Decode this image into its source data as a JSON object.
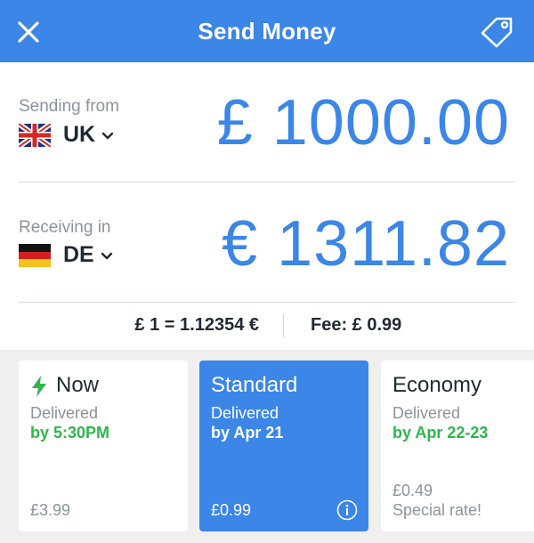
{
  "header": {
    "title": "Send Money"
  },
  "sending": {
    "label": "Sending from",
    "country": "UK",
    "amount": "£ 1000.00"
  },
  "receiving": {
    "label": "Receiving in",
    "country": "DE",
    "amount": "€ 1311.82"
  },
  "rate": {
    "text": "£ 1 = 1.12354 €",
    "fee": "Fee: £ 0.99"
  },
  "options": [
    {
      "name": "Now",
      "delivered_label": "Delivered",
      "when": "by 5:30PM",
      "price": "£3.99"
    },
    {
      "name": "Standard",
      "delivered_label": "Delivered",
      "when": "by Apr 21",
      "price": "£0.99",
      "selected": true
    },
    {
      "name": "Economy",
      "delivered_label": "Delivered",
      "when": "by Apr 22-23",
      "price": "£0.49",
      "note": "Special rate!"
    }
  ],
  "colors": {
    "accent": "#3b86e6",
    "success": "#2db74b",
    "muted": "#8a949c"
  }
}
